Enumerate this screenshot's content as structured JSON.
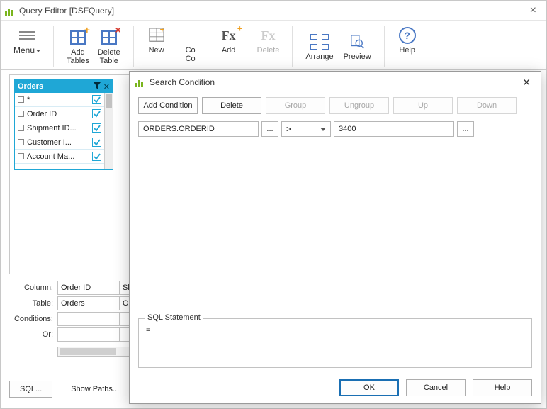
{
  "window": {
    "title": "Query Editor [DSFQuery]"
  },
  "ribbon": {
    "menu": "Menu",
    "add_tables": "Add\nTables",
    "delete_table": "Delete\nTable",
    "new": "New",
    "add": "Add",
    "delete": "Delete",
    "cond_partial": "Co\nCo",
    "arrange": "Arrange",
    "preview": "Preview",
    "help": "Help"
  },
  "orders_table": {
    "name": "Orders",
    "rows": [
      {
        "label": "*"
      },
      {
        "label": "Order ID"
      },
      {
        "label": "Shipment ID..."
      },
      {
        "label": "Customer I..."
      },
      {
        "label": "Account Ma..."
      }
    ]
  },
  "query_grid": {
    "row_labels": [
      "Column:",
      "Table:",
      "Conditions:",
      "Or:"
    ],
    "columns": [
      {
        "column": "Order ID",
        "table": "Orders",
        "conditions": "",
        "or": ""
      },
      {
        "column": "Ship",
        "table": "Ord",
        "conditions": "",
        "or": ""
      }
    ]
  },
  "bottom": {
    "sql": "SQL...",
    "show_paths": "Show Paths..."
  },
  "dialog": {
    "title": "Search Condition",
    "buttons": {
      "add": "Add Condition",
      "delete": "Delete",
      "group": "Group",
      "ungroup": "Ungroup",
      "up": "Up",
      "down": "Down"
    },
    "condition": {
      "column": "ORDERS.ORDERID",
      "operator": ">",
      "value": "3400",
      "ellipsis": "..."
    },
    "sql_label": "SQL Statement",
    "sql_text": "=",
    "footer": {
      "ok": "OK",
      "cancel": "Cancel",
      "help": "Help"
    }
  }
}
